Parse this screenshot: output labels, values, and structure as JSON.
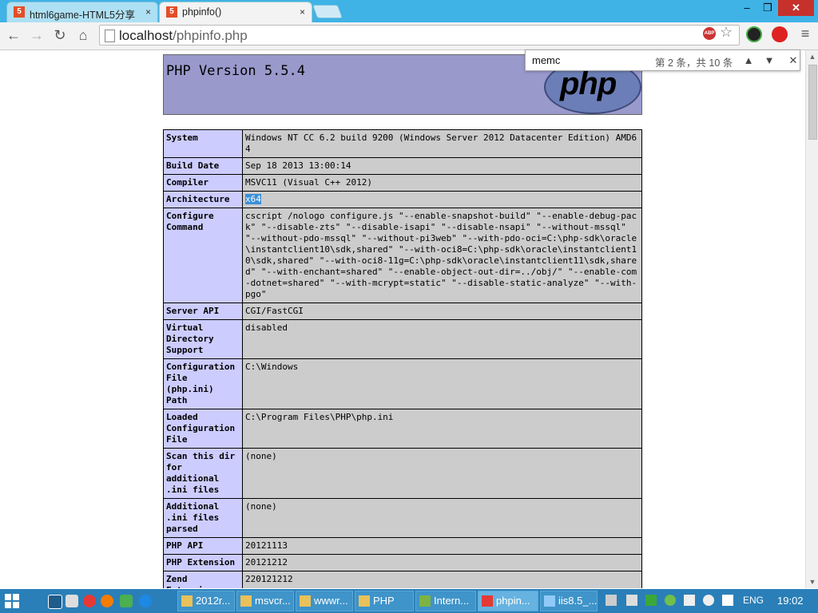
{
  "browser": {
    "tabs": [
      {
        "title": "html6game-HTML5分享",
        "close": "×",
        "icon": "html5-icon",
        "active": false
      },
      {
        "title": "phpinfo()",
        "close": "×",
        "icon": "html5-icon",
        "active": true
      }
    ],
    "window_buttons": {
      "minimize": "–",
      "maximize": "❐",
      "close": "✕"
    },
    "nav": {
      "back": "←",
      "forward": "→",
      "reload": "↻",
      "home": "⌂"
    },
    "url": {
      "host": "localhost",
      "path": "/phpinfo.php"
    },
    "extensions": {
      "abp": "ABP"
    }
  },
  "findbar": {
    "query": "memc",
    "count": "第 2 条，共 10 条",
    "up": "▲",
    "down": "▼",
    "close": "✕"
  },
  "page": {
    "title": "PHP Version 5.5.4",
    "logo": "php",
    "rows": [
      {
        "key": "System",
        "value": "Windows NT CC 6.2 build 9200 (Windows Server 2012 Datacenter Edition) AMD64"
      },
      {
        "key": "Build Date",
        "value": "Sep 18 2013 13:00:14"
      },
      {
        "key": "Compiler",
        "value": "MSVC11 (Visual C++ 2012)"
      },
      {
        "key": "Architecture",
        "value": "x64"
      },
      {
        "key": "Configure Command",
        "value": "cscript /nologo configure.js \"--enable-snapshot-build\" \"--enable-debug-pack\" \"--disable-zts\" \"--disable-isapi\" \"--disable-nsapi\" \"--without-mssql\" \"--without-pdo-mssql\" \"--without-pi3web\" \"--with-pdo-oci=C:\\php-sdk\\oracle\\instantclient10\\sdk,shared\" \"--with-oci8=C:\\php-sdk\\oracle\\instantclient10\\sdk,shared\" \"--with-oci8-11g=C:\\php-sdk\\oracle\\instantclient11\\sdk,shared\" \"--with-enchant=shared\" \"--enable-object-out-dir=../obj/\" \"--enable-com-dotnet=shared\" \"--with-mcrypt=static\" \"--disable-static-analyze\" \"--with-pgo\""
      },
      {
        "key": "Server API",
        "value": "CGI/FastCGI"
      },
      {
        "key": "Virtual Directory Support",
        "value": "disabled"
      },
      {
        "key": "Configuration File (php.ini) Path",
        "value": "C:\\Windows"
      },
      {
        "key": "Loaded Configuration File",
        "value": "C:\\Program Files\\PHP\\php.ini"
      },
      {
        "key": "Scan this dir for additional .ini files",
        "value": "(none)"
      },
      {
        "key": "Additional .ini files parsed",
        "value": "(none)"
      },
      {
        "key": "PHP API",
        "value": "20121113"
      },
      {
        "key": "PHP Extension",
        "value": "20121212"
      },
      {
        "key": "Zend Extension",
        "value": "220121212"
      }
    ]
  },
  "taskbar": {
    "tasks": [
      {
        "label": "2012r...",
        "icon": "folder-icon",
        "color": "#e8c15a"
      },
      {
        "label": "msvcr...",
        "icon": "folder-icon",
        "color": "#e8c15a"
      },
      {
        "label": "wwwr...",
        "icon": "folder-icon",
        "color": "#e8c15a"
      },
      {
        "label": "PHP",
        "icon": "folder-icon",
        "color": "#e8c15a"
      },
      {
        "label": "Intern...",
        "icon": "iis-manager-icon",
        "color": "#7cb342"
      },
      {
        "label": "phpin...",
        "icon": "chrome-icon",
        "color": "#e53935"
      },
      {
        "label": "iis8.5_...",
        "icon": "notepad-icon",
        "color": "#90caf9"
      }
    ],
    "language": "ENG",
    "time": "19:02"
  }
}
